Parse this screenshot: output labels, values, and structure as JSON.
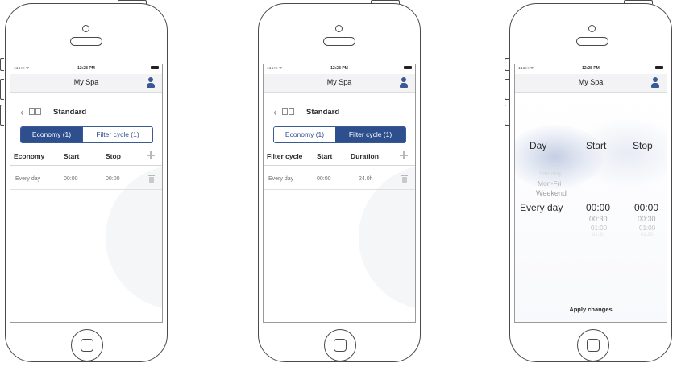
{
  "phones": [
    {
      "status": {
        "carrier": "●●●○○ ᯤ",
        "time": "12:28 PM"
      },
      "nav": {
        "title": "My Spa"
      },
      "preset_title": "Standard",
      "tabs": [
        {
          "label": "Economy (1)",
          "selected": true
        },
        {
          "label": "Filter cycle (1)",
          "selected": false
        }
      ],
      "headers": [
        "Economy",
        "Start",
        "Stop"
      ],
      "row": [
        "Every day",
        "00:00",
        "00:00"
      ]
    },
    {
      "status": {
        "carrier": "●●●○○ ᯤ",
        "time": "12:28 PM"
      },
      "nav": {
        "title": "My Spa"
      },
      "preset_title": "Standard",
      "tabs": [
        {
          "label": "Economy (1)",
          "selected": false
        },
        {
          "label": "Filter cycle (1)",
          "selected": true
        }
      ],
      "headers": [
        "Filter cycle",
        "Start",
        "Duration"
      ],
      "row": [
        "Every day",
        "00:00",
        "24.0h"
      ]
    },
    {
      "status": {
        "carrier": "●●●○○ ᯤ",
        "time": "12:28 PM"
      },
      "nav": {
        "title": "My Spa"
      },
      "picker": {
        "headers": [
          "Day",
          "Start",
          "Stop"
        ],
        "day_options_above": [
          "Saturday",
          "Mon-Fri",
          "Weekend"
        ],
        "day_selected": "Every day",
        "start_selected": "00:00",
        "start_options_below": [
          "00:30",
          "01:00",
          "01:30"
        ],
        "stop_selected": "00:00",
        "stop_options_below": [
          "00:30",
          "01:00",
          "01:30"
        ]
      },
      "apply_label": "Apply changes"
    }
  ],
  "colors": {
    "accent": "#2e4f8e",
    "outline": "#4a4a4a"
  }
}
